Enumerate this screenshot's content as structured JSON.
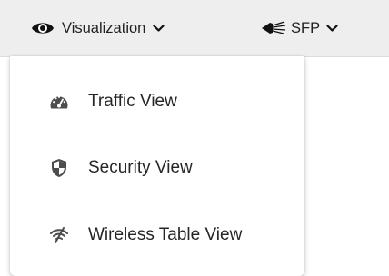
{
  "toolbar": {
    "visualization": {
      "label": "Visualization",
      "icon": "eye-icon"
    },
    "sfp": {
      "label": "SFP",
      "icon": "fiber-cable-icon"
    }
  },
  "menu": {
    "items": [
      {
        "label": "Traffic View",
        "icon": "speedometer-icon"
      },
      {
        "label": "Security View",
        "icon": "shield-icon"
      },
      {
        "label": "Wireless Table View",
        "icon": "wireless-signal-icon"
      }
    ]
  },
  "colors": {
    "toolbar_bg": "#eeeeee",
    "icon": "#4d4d4d",
    "text": "#262626"
  }
}
